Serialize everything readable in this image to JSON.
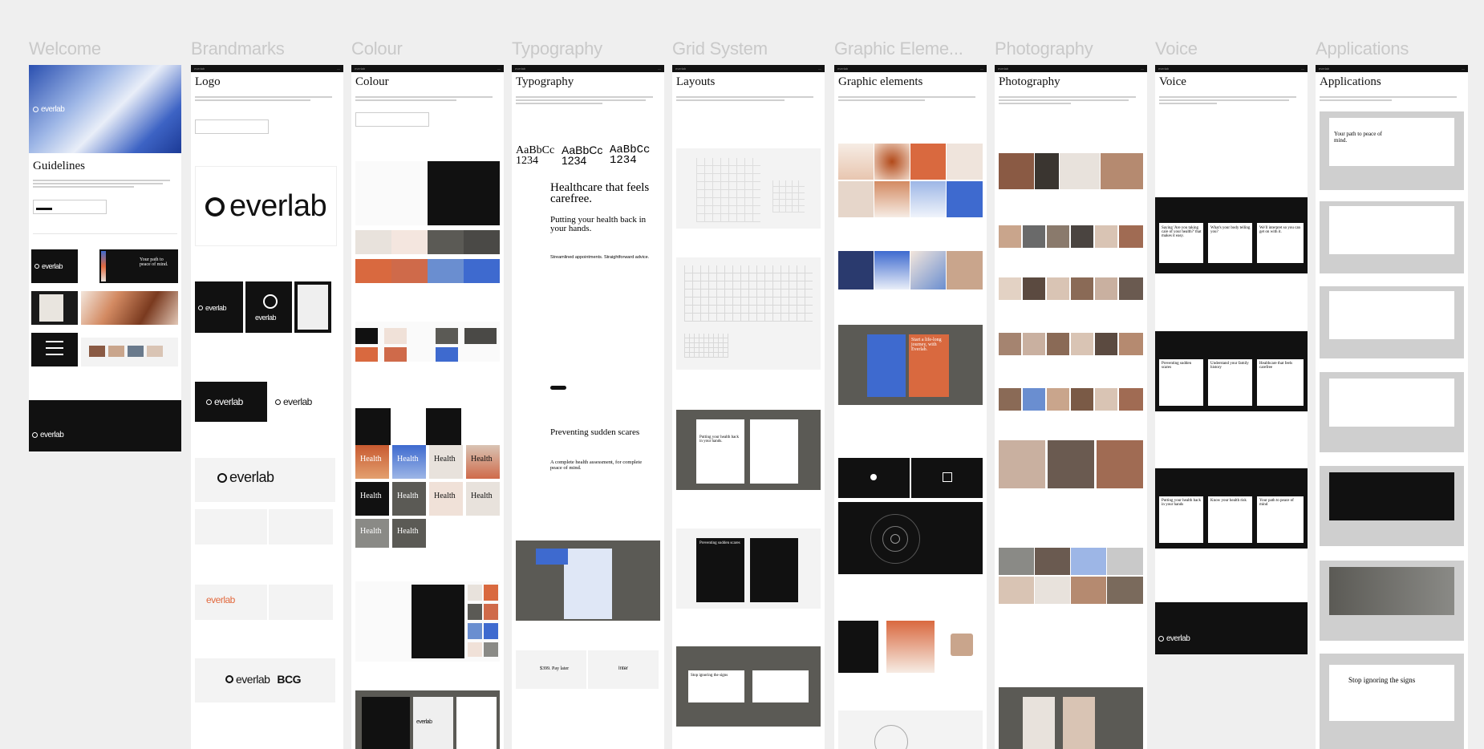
{
  "columns": [
    {
      "title": "Welcome",
      "page_heading": "Guidelines"
    },
    {
      "title": "Brandmarks",
      "page_heading": "Logo"
    },
    {
      "title": "Colour",
      "page_heading": "Colour"
    },
    {
      "title": "Typography",
      "page_heading": "Typography"
    },
    {
      "title": "Grid System",
      "page_heading": "Layouts"
    },
    {
      "title": "Graphic Eleme...",
      "page_heading": "Graphic elements"
    },
    {
      "title": "Photography",
      "page_heading": "Photography"
    },
    {
      "title": "Voice",
      "page_heading": "Voice"
    },
    {
      "title": "Applications",
      "page_heading": "Applications"
    }
  ],
  "brand": {
    "wordmark": "everlab",
    "partner": "BCG"
  },
  "welcome": {
    "hero_word": "everlab",
    "footer_word": "everlab",
    "tag1": "Your path to peace of mind."
  },
  "typography": {
    "specimen_a": "AaBbCc 1234",
    "specimen_b": "AaBbCc 1234",
    "specimen_c": "AaBbCc 1234",
    "display_1": "Healthcare that feels carefree.",
    "display_2": "Putting your health back in your hands.",
    "display_3": "Preventing sudden scares",
    "display_4": "A complete health assessment, for complete peace of mind.",
    "big_tag": "Streamlined appointments. Straightforward advice.",
    "price_1": "$399. Pay later",
    "price_2": "Inter"
  },
  "colour": {
    "health": "Health",
    "swatches": [
      "#111111",
      "#e8e2dc",
      "#f4e6df",
      "#5b5a55",
      "#d9693f",
      "#cf6a4a",
      "#6a8ed0",
      "#3e6acf",
      "#f0e1d8",
      "#8a8a86"
    ]
  },
  "grid": {
    "card_1": "Putting your health back in your hands.",
    "card_2": "Preventing sudden scares",
    "card_3": "Stop ignoring the signs"
  },
  "graphic": {
    "poster_a": "Start a life-long journey, with Everlab."
  },
  "voice": {
    "v1": "Saying 'Are you taking care of your health?' that makes it easy.",
    "v2": "What's your body telling you?",
    "v3": "We'll interpret so you can get on with it.",
    "v4": "Preventing sudden scares",
    "v5": "Understand your family history",
    "v6": "Healthcare that feels carefree",
    "v7": "Putting your health back in your hands",
    "v8": "Know your health risk",
    "v9": "Your path to peace of mind",
    "footer_word": "everlab"
  },
  "applications": {
    "a1": "Your path to peace of mind.",
    "a2": "Stop ignoring the signs"
  }
}
